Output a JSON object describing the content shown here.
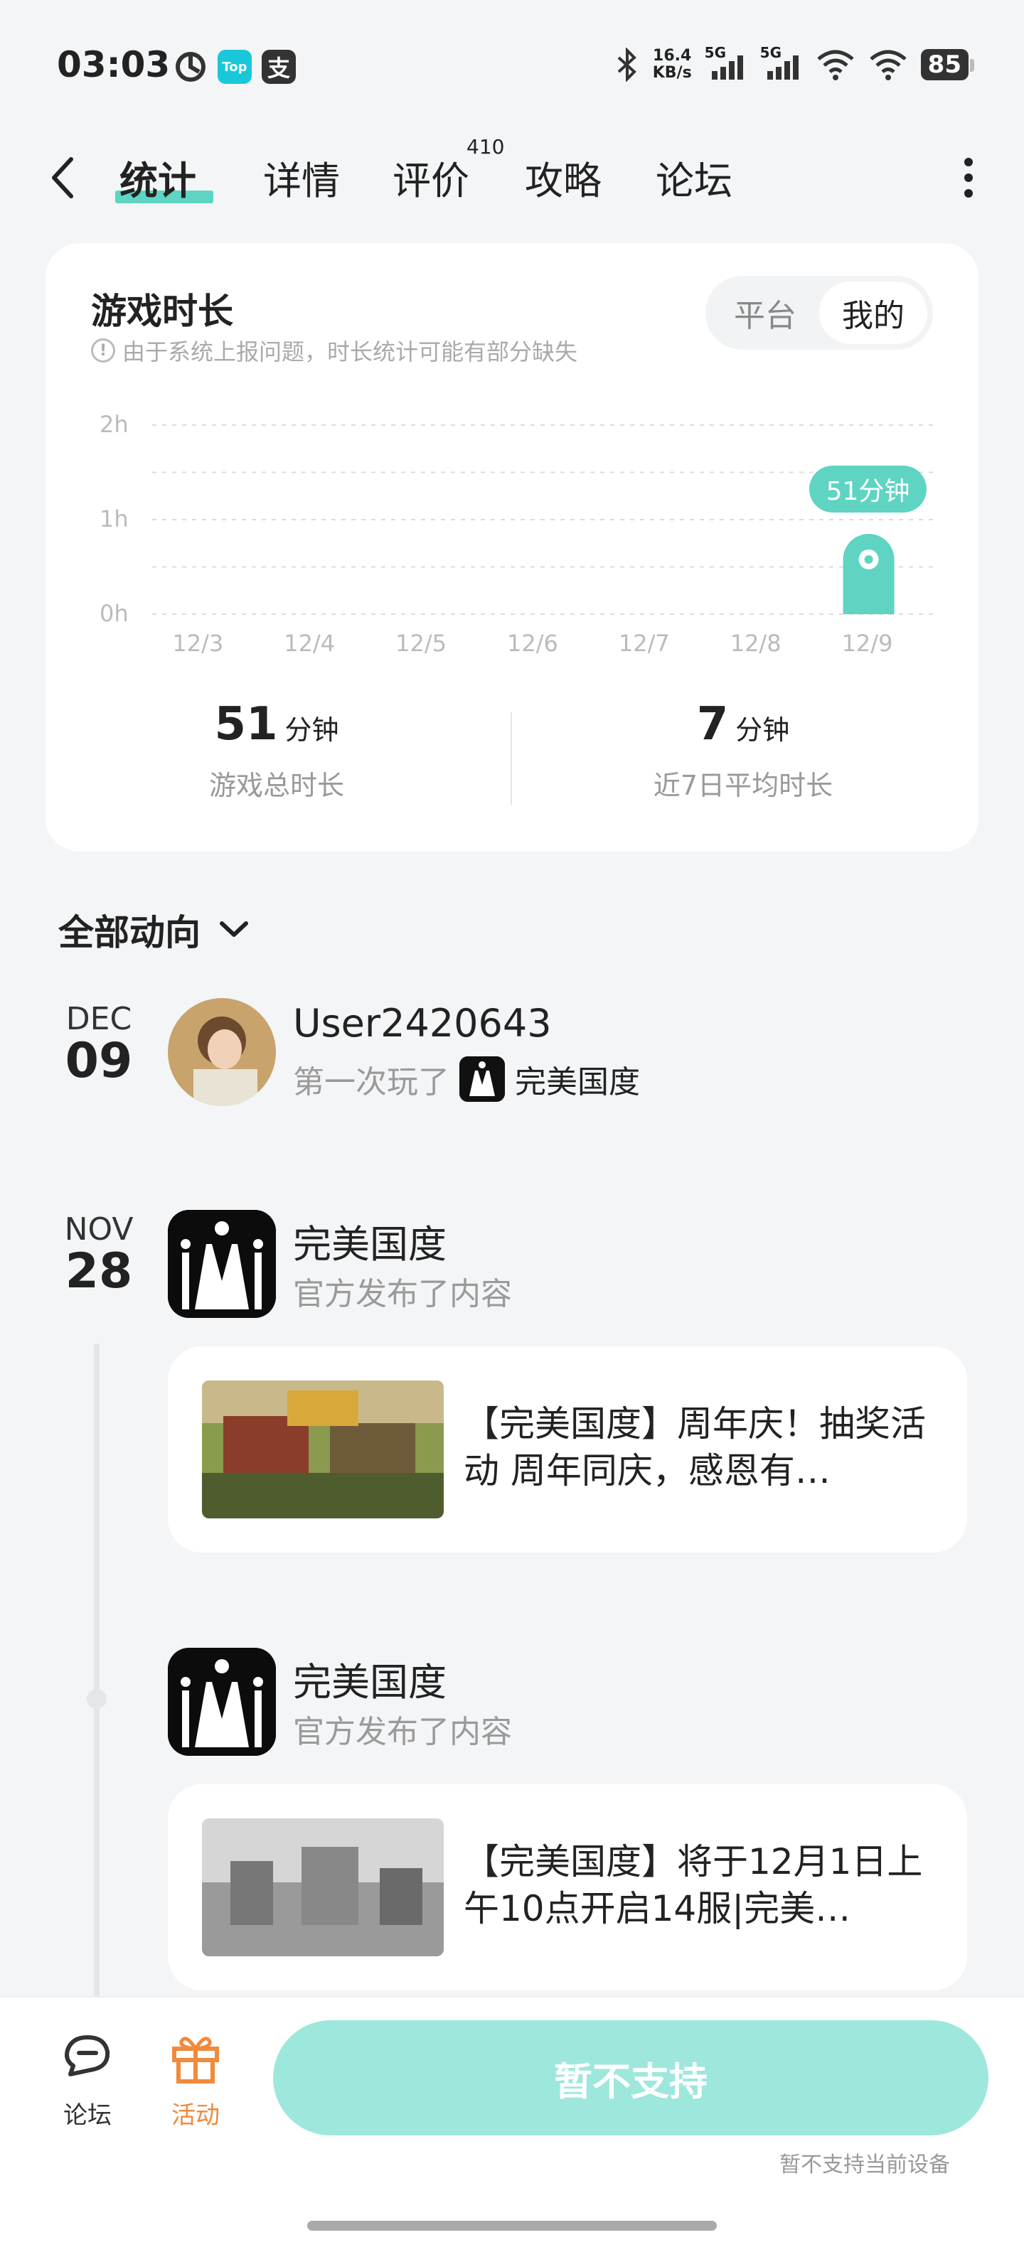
{
  "status_bar": {
    "time": "03:03",
    "app_icons": [
      "netease-icon",
      "taptap-icon",
      "alipay-icon"
    ],
    "taptap_label": "Top",
    "alipay_label": "支",
    "net_speed_value": "16.4",
    "net_speed_unit": "KB/s",
    "signal_1_label": "5G",
    "signal_2_label": "5G",
    "battery": "85"
  },
  "nav": {
    "tabs": [
      {
        "label": "统计",
        "active": true
      },
      {
        "label": "详情",
        "active": false
      },
      {
        "label": "评价",
        "active": false
      },
      {
        "label": "攻略",
        "active": false
      },
      {
        "label": "论坛",
        "active": false
      }
    ],
    "review_count": "410"
  },
  "stats": {
    "title": "游戏时长",
    "note": "由于系统上报问题，时长统计可能有部分缺失",
    "toggle": [
      {
        "label": "平台",
        "active": false
      },
      {
        "label": "我的",
        "active": true
      }
    ],
    "total_value": "51",
    "total_unit": "分钟",
    "total_label": "游戏总时长",
    "avg_value": "7",
    "avg_unit": "分钟",
    "avg_label": "近7日平均时长"
  },
  "chart_data": {
    "type": "bar",
    "categories": [
      "12/3",
      "12/4",
      "12/5",
      "12/6",
      "12/7",
      "12/8",
      "12/9"
    ],
    "values": [
      0,
      0,
      0,
      0,
      0,
      0,
      51
    ],
    "value_unit": "minutes",
    "y_ticks": [
      "2h",
      "1h",
      "0h"
    ],
    "ylim": [
      0,
      120
    ],
    "highlight_label": "51分钟",
    "bar_color": "#5fd4c3"
  },
  "feed": {
    "filter_label": "全部动向",
    "items": [
      {
        "month": "DEC",
        "day": "09",
        "name": "User2420643",
        "sub_prefix": "第一次玩了",
        "sub_game": "完美国度"
      },
      {
        "month": "NOV",
        "day": "28",
        "name": "完美国度",
        "sub": "官方发布了内容",
        "post_title": "【完美国度】周年庆！抽奖活动 周年同庆，感恩有…"
      },
      {
        "name": "完美国度",
        "sub": "官方发布了内容",
        "post_title": "【完美国度】将于12月1日上午10点开启14服|完美…"
      }
    ]
  },
  "bottom": {
    "forum_label": "论坛",
    "activity_label": "活动",
    "cta_label": "暂不支持",
    "cta_note": "暂不支持当前设备"
  },
  "colors": {
    "accent": "#5fd4c3",
    "cta": "#9ee7dc",
    "activity": "#f08a3c"
  }
}
